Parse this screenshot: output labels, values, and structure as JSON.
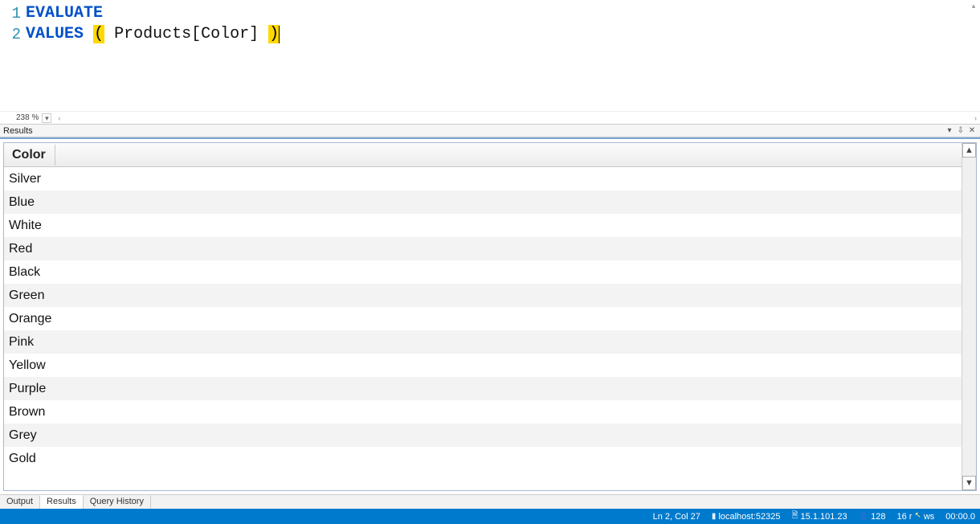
{
  "editor": {
    "lines": [
      {
        "num": "1",
        "tokens": [
          {
            "t": "kw",
            "v": "EVALUATE"
          }
        ]
      },
      {
        "num": "2",
        "tokens": [
          {
            "t": "kw",
            "v": "VALUES"
          },
          {
            "t": "sp",
            "v": " "
          },
          {
            "t": "paren",
            "v": "("
          },
          {
            "t": "sp",
            "v": " "
          },
          {
            "t": "ident",
            "v": "Products[Color]"
          },
          {
            "t": "sp",
            "v": " "
          },
          {
            "t": "paren",
            "v": ")"
          }
        ]
      }
    ],
    "zoom": "238 %"
  },
  "results": {
    "panel_title": "Results",
    "column_header": "Color",
    "rows": [
      "Silver",
      "Blue",
      "White",
      "Red",
      "Black",
      "Green",
      "Orange",
      "Pink",
      "Yellow",
      "Purple",
      "Brown",
      "Grey",
      "Gold"
    ]
  },
  "tabs": {
    "output": "Output",
    "results": "Results",
    "history": "Query History"
  },
  "status": {
    "position": "Ln 2, Col 27",
    "server": "localhost:52325",
    "version": "15.1.101.23",
    "spid": "128",
    "rows": "16 rows",
    "elapsed": "00:00.0"
  },
  "icons": {
    "dropdown": "▾",
    "pin": "⇩",
    "close": "✕",
    "up": "▲",
    "down": "▼",
    "db": "▮",
    "doc": "🗎",
    "user": "👤",
    "left": "‹",
    "right": "›"
  }
}
